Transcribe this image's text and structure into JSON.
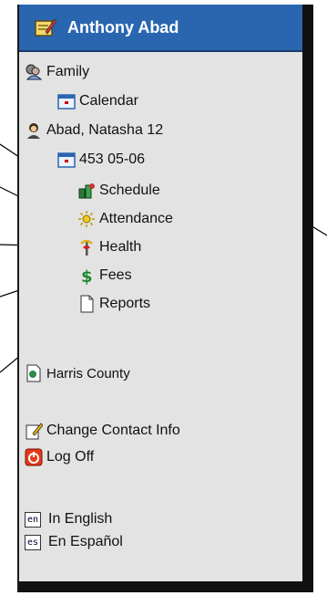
{
  "header": {
    "title": "Anthony Abad"
  },
  "family": {
    "label": "Family",
    "calendar_label": "Calendar"
  },
  "student": {
    "label": "Abad, Natasha 12",
    "term_label": "453 05-06",
    "menu": [
      {
        "label": "Schedule",
        "icon": "schedule-icon"
      },
      {
        "label": "Attendance",
        "icon": "attendance-icon"
      },
      {
        "label": "Health",
        "icon": "health-icon"
      },
      {
        "label": "Fees",
        "icon": "fees-icon"
      },
      {
        "label": "Reports",
        "icon": "reports-icon"
      }
    ]
  },
  "district": {
    "label": "Harris County"
  },
  "account": {
    "change_contact_label": "Change Contact Info",
    "logoff_label": "Log Off"
  },
  "language": {
    "english": {
      "code": "en",
      "label": "In English"
    },
    "spanish": {
      "code": "es",
      "label": "En Español"
    }
  },
  "colors": {
    "header_bg": "#2a66b0",
    "panel_bg": "#e3e3e3"
  }
}
